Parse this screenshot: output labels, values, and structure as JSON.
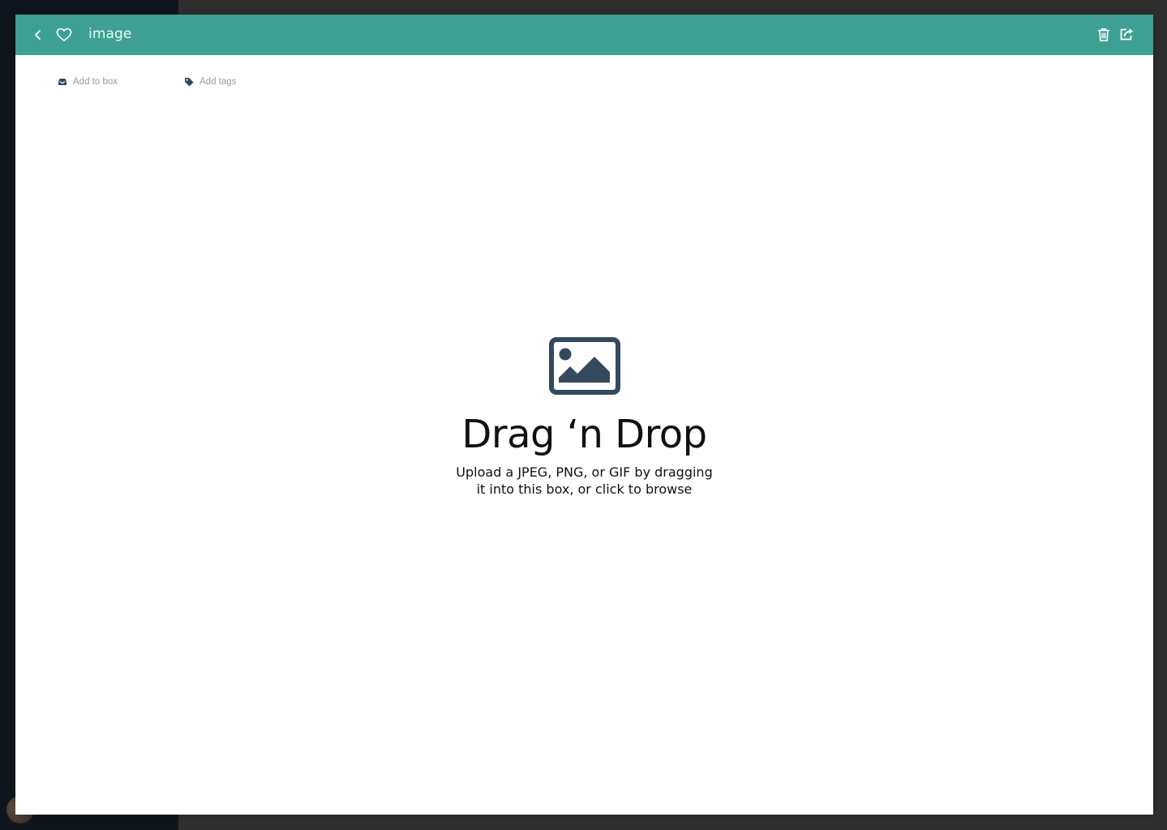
{
  "modal": {
    "title": "image",
    "colors": {
      "header": "#3da092",
      "icon_dark": "#34495e"
    },
    "icons": {
      "back": "chevron-left-icon",
      "favorite": "heart-icon",
      "delete": "trash-icon",
      "share": "share-icon"
    }
  },
  "meta": {
    "add_to_box": "Add to box",
    "add_tags": "Add tags"
  },
  "dropzone": {
    "icon": "image-icon",
    "title": "Drag ‘n Drop",
    "subtitle": "Upload a JPEG, PNG, or GIF by dragging it into this box, or click to browse"
  }
}
